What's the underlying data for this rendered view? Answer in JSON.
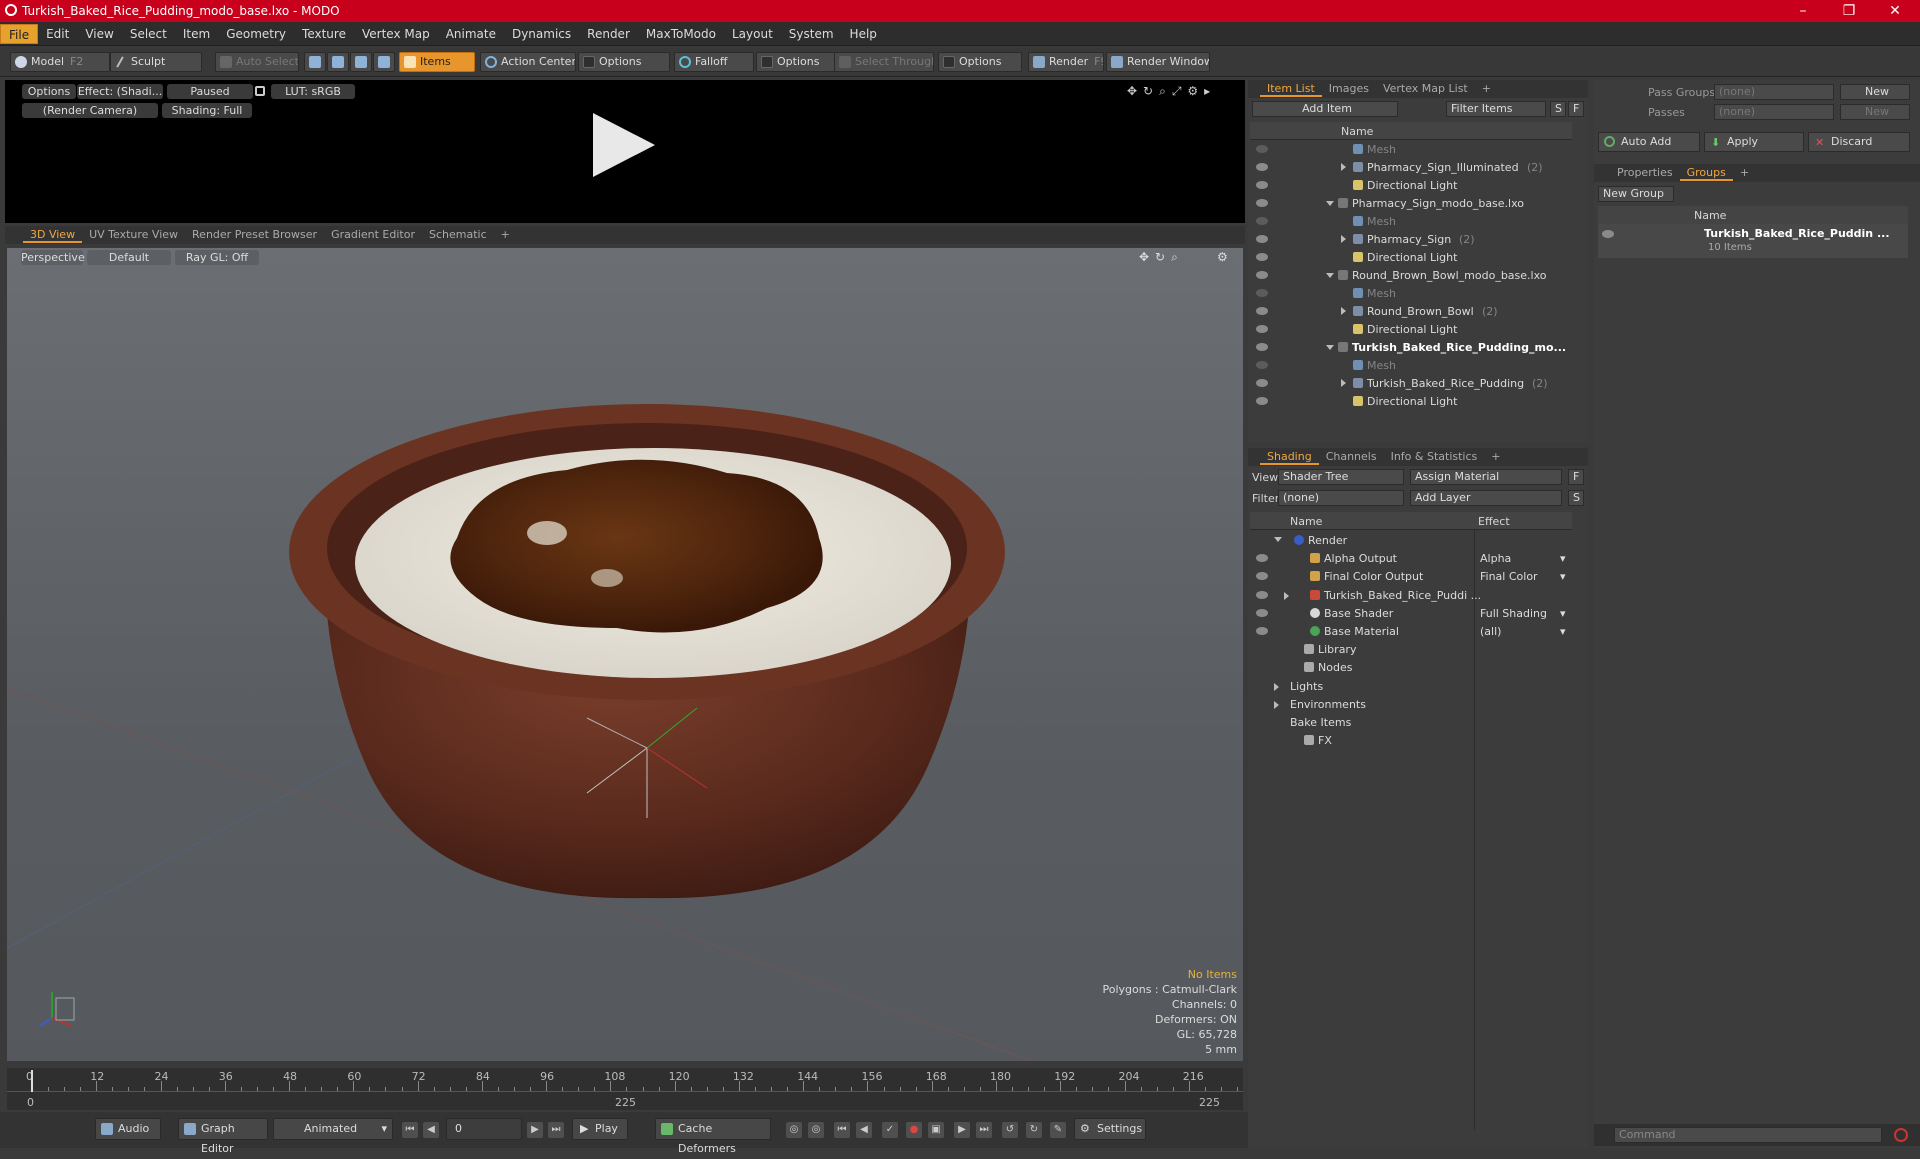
{
  "window": {
    "title": "Turkish_Baked_Rice_Pudding_modo_base.lxo - MODO",
    "minimize": "–",
    "maximize": "❐",
    "close": "✕"
  },
  "menu": [
    "File",
    "Edit",
    "View",
    "Select",
    "Item",
    "Geometry",
    "Texture",
    "Vertex Map",
    "Animate",
    "Dynamics",
    "Render",
    "MaxToModo",
    "Layout",
    "System",
    "Help"
  ],
  "toolbar": {
    "model": "Model",
    "model_key": "F2",
    "sculpt": "Sculpt",
    "auto_select": "Auto Select",
    "items": "Items",
    "action_center": "Action Center",
    "options1": "Options",
    "falloff": "Falloff",
    "options2": "Options",
    "select_through": "Select Through",
    "options3": "Options",
    "render": "Render",
    "render_key": "F9",
    "render_window": "Render Window"
  },
  "preview": {
    "options": "Options",
    "effect": "Effect: (Shadi...",
    "paused": "Paused",
    "lut": "LUT: sRGB",
    "camera": "(Render Camera)",
    "shading": "Shading: Full"
  },
  "viewport_tabs": [
    "3D View",
    "UV Texture View",
    "Render Preset Browser",
    "Gradient Editor",
    "Schematic",
    "+"
  ],
  "viewport": {
    "perspective": "Perspective",
    "default": "Default",
    "raygl": "Ray GL: Off"
  },
  "stats": {
    "no_items": "No Items",
    "polygons": "Polygons : Catmull-Clark",
    "channels": "Channels: 0",
    "deformers": "Deformers: ON",
    "gl": "GL: 65,728",
    "unit": "5 mm"
  },
  "timeline": {
    "ticks": [
      "0",
      "12",
      "24",
      "36",
      "48",
      "60",
      "72",
      "84",
      "96",
      "108",
      "120",
      "132",
      "144",
      "156",
      "168",
      "180",
      "192",
      "204",
      "216"
    ],
    "bottom_left": "0",
    "bottom_mid": "225",
    "bottom_right": "225"
  },
  "bottom": {
    "audio": "Audio",
    "graph_editor": "Graph Editor",
    "animated": "Animated",
    "frame": "0",
    "play": "Play",
    "cache": "Cache Deformers",
    "settings": "Settings"
  },
  "item_list": {
    "tabs": [
      "Item List",
      "Images",
      "Vertex Map List",
      "+"
    ],
    "add_item": "Add Item",
    "filter": "Filter Items",
    "s": "S",
    "f": "F",
    "col_name": "Name",
    "rows": [
      {
        "label": "Mesh",
        "count": "",
        "indent": 3,
        "style": "gray"
      },
      {
        "label": "Pharmacy_Sign_Illuminated",
        "count": "(2)",
        "indent": 3,
        "style": "normal"
      },
      {
        "label": "Directional Light",
        "count": "",
        "indent": 3,
        "style": "normal"
      },
      {
        "label": "Pharmacy_Sign_modo_base.lxo",
        "count": "",
        "indent": 2,
        "style": "normal"
      },
      {
        "label": "Mesh",
        "count": "",
        "indent": 3,
        "style": "gray"
      },
      {
        "label": "Pharmacy_Sign",
        "count": "(2)",
        "indent": 3,
        "style": "normal"
      },
      {
        "label": "Directional Light",
        "count": "",
        "indent": 3,
        "style": "normal"
      },
      {
        "label": "Round_Brown_Bowl_modo_base.lxo",
        "count": "",
        "indent": 2,
        "style": "normal"
      },
      {
        "label": "Mesh",
        "count": "",
        "indent": 3,
        "style": "gray"
      },
      {
        "label": "Round_Brown_Bowl",
        "count": "(2)",
        "indent": 3,
        "style": "normal"
      },
      {
        "label": "Directional Light",
        "count": "",
        "indent": 3,
        "style": "normal"
      },
      {
        "label": "Turkish_Baked_Rice_Pudding_mo...",
        "count": "",
        "indent": 2,
        "style": "bold"
      },
      {
        "label": "Mesh",
        "count": "",
        "indent": 3,
        "style": "gray"
      },
      {
        "label": "Turkish_Baked_Rice_Pudding",
        "count": "(2)",
        "indent": 3,
        "style": "normal"
      },
      {
        "label": "Directional Light",
        "count": "",
        "indent": 3,
        "style": "normal"
      }
    ]
  },
  "shading": {
    "tabs": [
      "Shading",
      "Channels",
      "Info & Statistics",
      "+"
    ],
    "view_label": "View",
    "view_value": "Shader Tree",
    "assign": "Assign Material",
    "filter_label": "Filter",
    "filter_value": "(none)",
    "add_layer": "Add Layer",
    "f": "F",
    "s": "S",
    "col_name": "Name",
    "col_effect": "Effect",
    "rows": [
      {
        "label": "Render",
        "effect": "",
        "indent": 1
      },
      {
        "label": "Alpha Output",
        "effect": "Alpha",
        "indent": 2
      },
      {
        "label": "Final Color Output",
        "effect": "Final Color",
        "indent": 2
      },
      {
        "label": "Turkish_Baked_Rice_Puddi ...",
        "effect": "",
        "indent": 2
      },
      {
        "label": "Base Shader",
        "effect": "Full Shading",
        "indent": 2
      },
      {
        "label": "Base Material",
        "effect": "(all)",
        "indent": 2
      },
      {
        "label": "Library",
        "effect": "",
        "indent": 1
      },
      {
        "label": "Nodes",
        "effect": "",
        "indent": 1
      },
      {
        "label": "Lights",
        "effect": "",
        "indent": 0
      },
      {
        "label": "Environments",
        "effect": "",
        "indent": 0
      },
      {
        "label": "Bake Items",
        "effect": "",
        "indent": 0
      },
      {
        "label": "FX",
        "effect": "",
        "indent": 1
      }
    ]
  },
  "right": {
    "pass_groups": "Pass Groups",
    "passes": "Passes",
    "none": "(none)",
    "new": "New",
    "auto_add": "Auto Add",
    "apply": "Apply",
    "discard": "Discard",
    "tabs": [
      "Properties",
      "Groups",
      "+"
    ],
    "new_group": "New Group",
    "col_name": "Name",
    "group_name": "Turkish_Baked_Rice_Puddin ...",
    "group_count": "10 Items",
    "command": "Command"
  }
}
